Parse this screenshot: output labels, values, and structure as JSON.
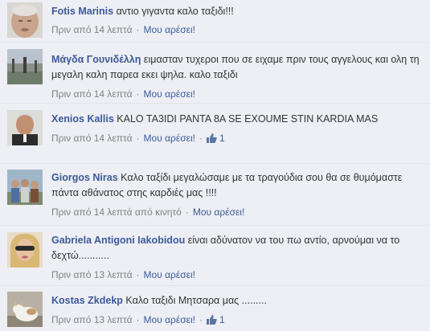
{
  "comments": [
    {
      "author": "Fotis Marinis",
      "text": "αντιο γιγαντα καλο ταξιδι!!!",
      "time": "Πριν από 14 λεπτά",
      "like_label": "Μου αρέσει!",
      "likes": ""
    },
    {
      "author": "Μάγδα Γουνιδέλλη",
      "text": "ειμασταν τυχεροι που σε ειχαμε πριν τους αγγελους και ολη τη μεγαλη καλη παρεα εκει ψηλα. καλο ταξιδι",
      "time": "Πριν από 14 λεπτά",
      "like_label": "Μου αρέσει!",
      "likes": ""
    },
    {
      "author": "Xenios Kallis",
      "text": "KALO TA3IDI PANTA 8A SE EXOUME STIN KARDIA MAS",
      "time": "Πριν από 14 λεπτά",
      "like_label": "Μου αρέσει!",
      "likes": "1"
    },
    {
      "author": "Giorgos Niras",
      "text": "Καλο ταξίδι μεγαλώσαμε με τα τραγούδια σου θα σε θυμόμαστε πάντα αθάνατος στης καρδιές μας !!!!",
      "time": "Πριν από 14 λεπτά από κινητό",
      "like_label": "Μου αρέσει!",
      "likes": ""
    },
    {
      "author": "Gabriela Antigoni Iakobidou",
      "text": "είναι αδύνατον να του πω αντίο, αρνούμαι να το δεχτώ...........",
      "time": "Πριν από 13 λεπτά",
      "like_label": "Μου αρέσει!",
      "likes": ""
    },
    {
      "author": "Kostas Zkdekp",
      "text": "Καλο ταξιδι Μητσαρα μας .........",
      "time": "Πριν από 13 λεπτά",
      "like_label": "Μου αρέσει!",
      "likes": "1"
    }
  ],
  "colors": {
    "link": "#3b5998",
    "meta": "#808080",
    "background": "#edeff4"
  },
  "icons": {
    "like_count": "thumbs-up-icon"
  }
}
